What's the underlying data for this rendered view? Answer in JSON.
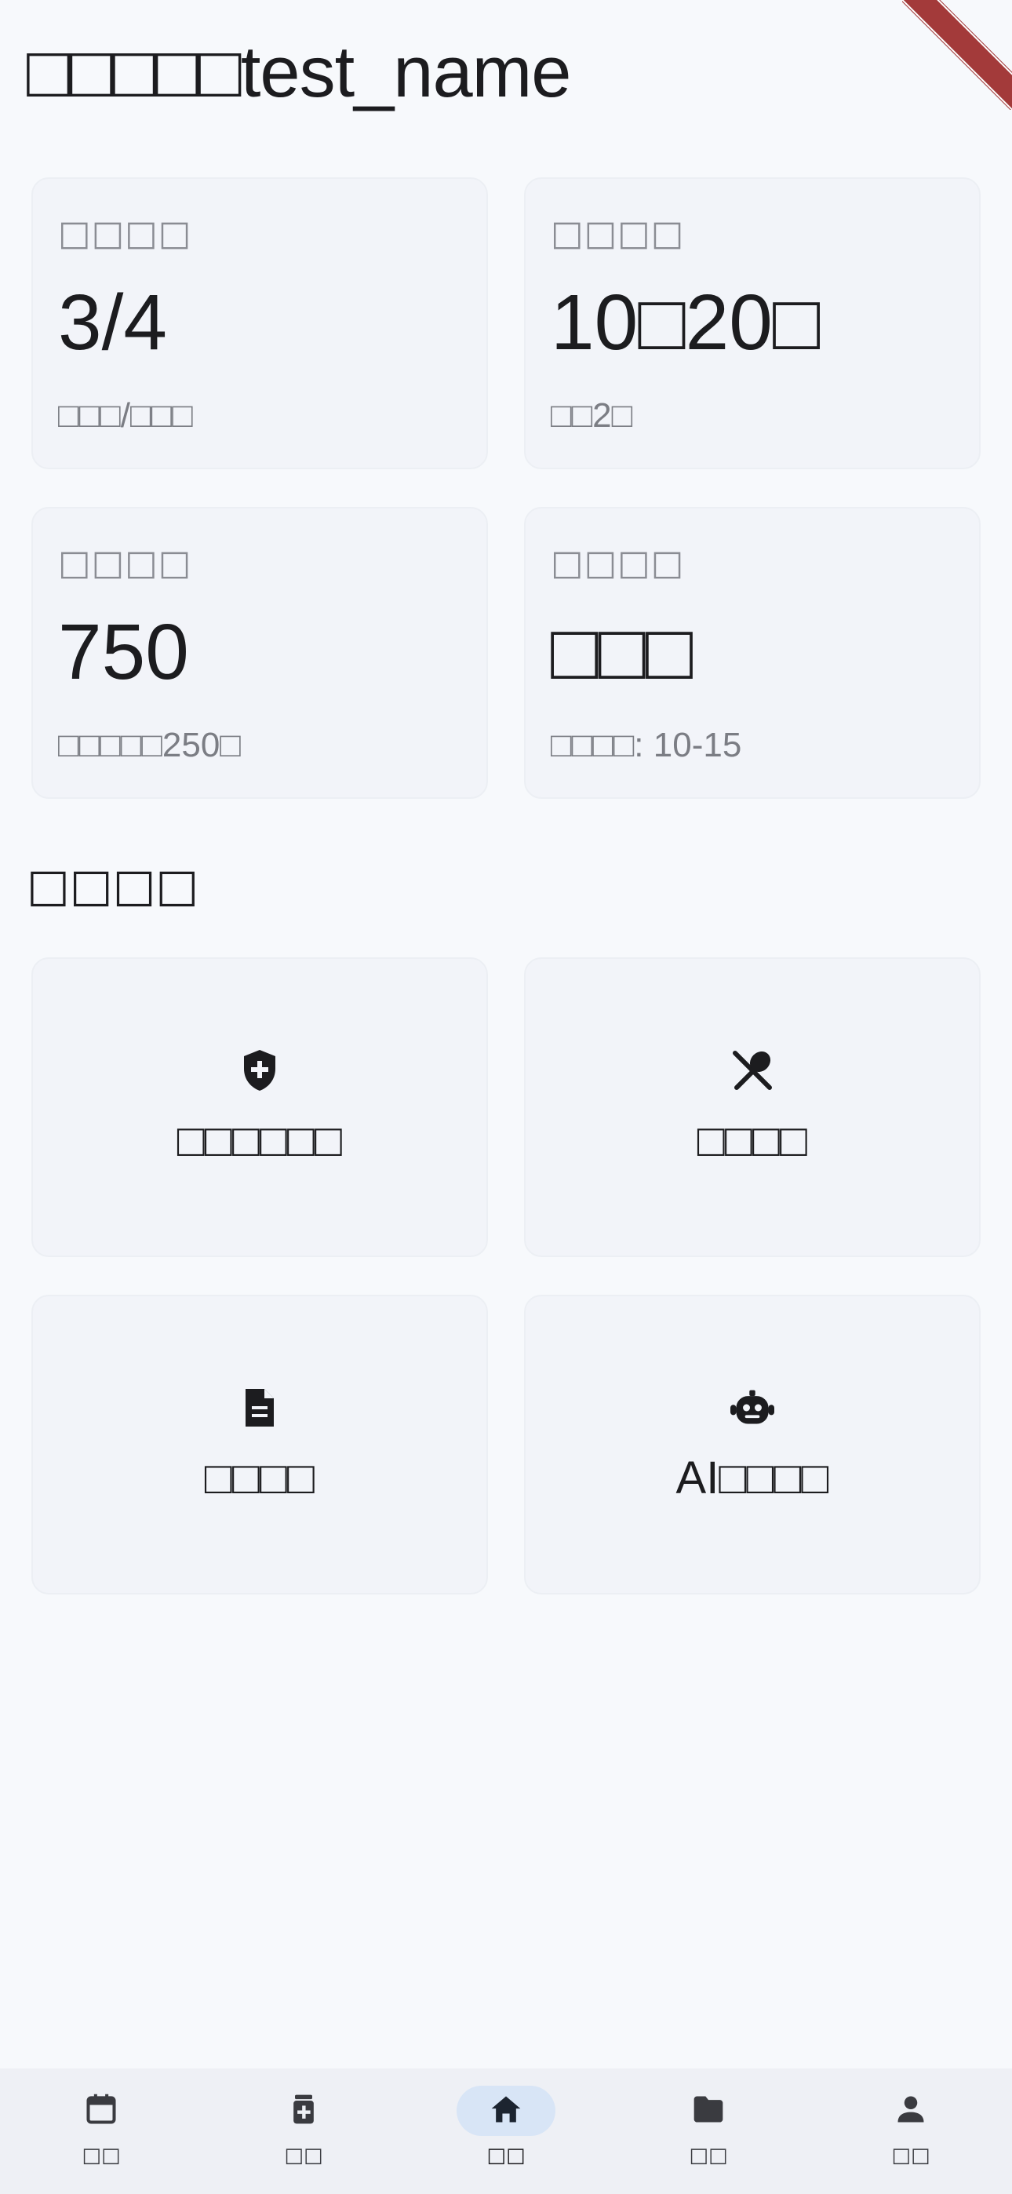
{
  "header": {
    "greeting": "□□□□□test_name"
  },
  "stats": [
    {
      "label": "□□□□",
      "value": "3/4",
      "sub": "□□□/□□□"
    },
    {
      "label": "□□□□",
      "value": "10□20□",
      "sub": "□□2□"
    },
    {
      "label": "□□□□",
      "value": "750",
      "sub": "□□□□□250□"
    },
    {
      "label": "□□□□",
      "value": "□□□",
      "sub": "□□□□: 10-15"
    }
  ],
  "quick_actions": {
    "title": "□□□□",
    "items": [
      {
        "label": "□□□□□□",
        "icon": "shield-plus-icon"
      },
      {
        "label": "□□□□",
        "icon": "utensils-icon"
      },
      {
        "label": "□□□□",
        "icon": "document-icon"
      },
      {
        "label": "AI□□□□",
        "icon": "robot-icon"
      }
    ]
  },
  "bottom_nav": {
    "items": [
      {
        "label": "□□",
        "icon": "calendar-icon",
        "active": false
      },
      {
        "label": "□□",
        "icon": "medicine-icon",
        "active": false
      },
      {
        "label": "□□",
        "icon": "home-icon",
        "active": true
      },
      {
        "label": "□□",
        "icon": "folder-icon",
        "active": false
      },
      {
        "label": "□□",
        "icon": "person-icon",
        "active": false
      }
    ]
  },
  "colors": {
    "background": "#f7f9fc",
    "card": "#f2f4f9",
    "nav_active_pill": "#d8e5f6",
    "debug_ribbon": "#a33a3a"
  }
}
